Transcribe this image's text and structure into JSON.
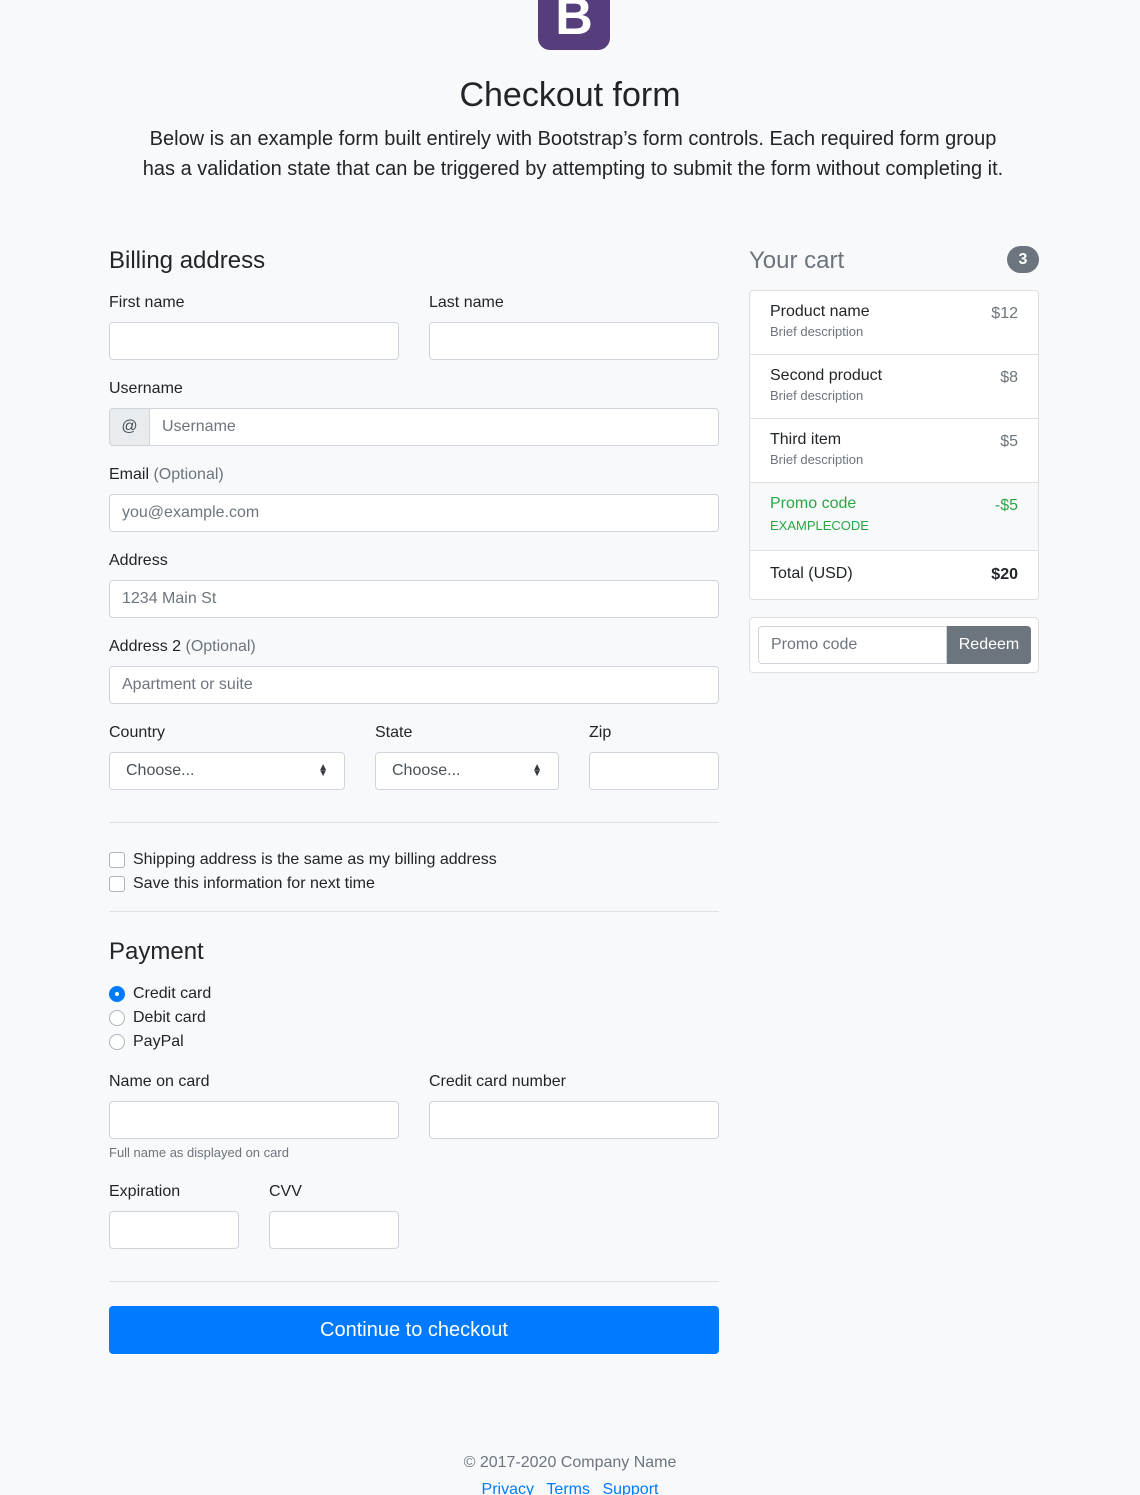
{
  "header": {
    "logo_letter": "B",
    "title": "Checkout form",
    "lead": "Below is an example form built entirely with Bootstrap’s form controls. Each required form group has a validation state that can be triggered by attempting to submit the form without completing it."
  },
  "billing": {
    "heading": "Billing address",
    "first_name_label": "First name",
    "last_name_label": "Last name",
    "username_label": "Username",
    "username_addon": "@",
    "username_placeholder": "Username",
    "email_label": "Email",
    "email_optional": "(Optional)",
    "email_placeholder": "you@example.com",
    "address_label": "Address",
    "address_placeholder": "1234 Main St",
    "address2_label": "Address 2",
    "address2_optional": "(Optional)",
    "address2_placeholder": "Apartment or suite",
    "country_label": "Country",
    "country_value": "Choose...",
    "state_label": "State",
    "state_value": "Choose...",
    "zip_label": "Zip",
    "same_address_label": "Shipping address is the same as my billing address",
    "save_info_label": "Save this information for next time"
  },
  "payment": {
    "heading": "Payment",
    "options": [
      {
        "label": "Credit card",
        "selected": true
      },
      {
        "label": "Debit card",
        "selected": false
      },
      {
        "label": "PayPal",
        "selected": false
      }
    ],
    "name_on_card_label": "Name on card",
    "name_on_card_help": "Full name as displayed on card",
    "card_number_label": "Credit card number",
    "expiration_label": "Expiration",
    "cvv_label": "CVV",
    "submit_label": "Continue to checkout"
  },
  "cart": {
    "heading": "Your cart",
    "count": "3",
    "items": [
      {
        "name": "Product name",
        "description": "Brief description",
        "price": "$12"
      },
      {
        "name": "Second product",
        "description": "Brief description",
        "price": "$8"
      },
      {
        "name": "Third item",
        "description": "Brief description",
        "price": "$5"
      }
    ],
    "promo": {
      "name": "Promo code",
      "code": "EXAMPLECODE",
      "amount": "-$5"
    },
    "total_label": "Total (USD)",
    "total_value": "$20",
    "promo_placeholder": "Promo code",
    "redeem_label": "Redeem"
  },
  "footer": {
    "copyright": "© 2017-2020 Company Name",
    "links": [
      "Privacy",
      "Terms",
      "Support"
    ]
  },
  "colors": {
    "primary": "#007bff",
    "secondary": "#6c757d",
    "success": "#28a745",
    "brand": "#563d7c"
  }
}
